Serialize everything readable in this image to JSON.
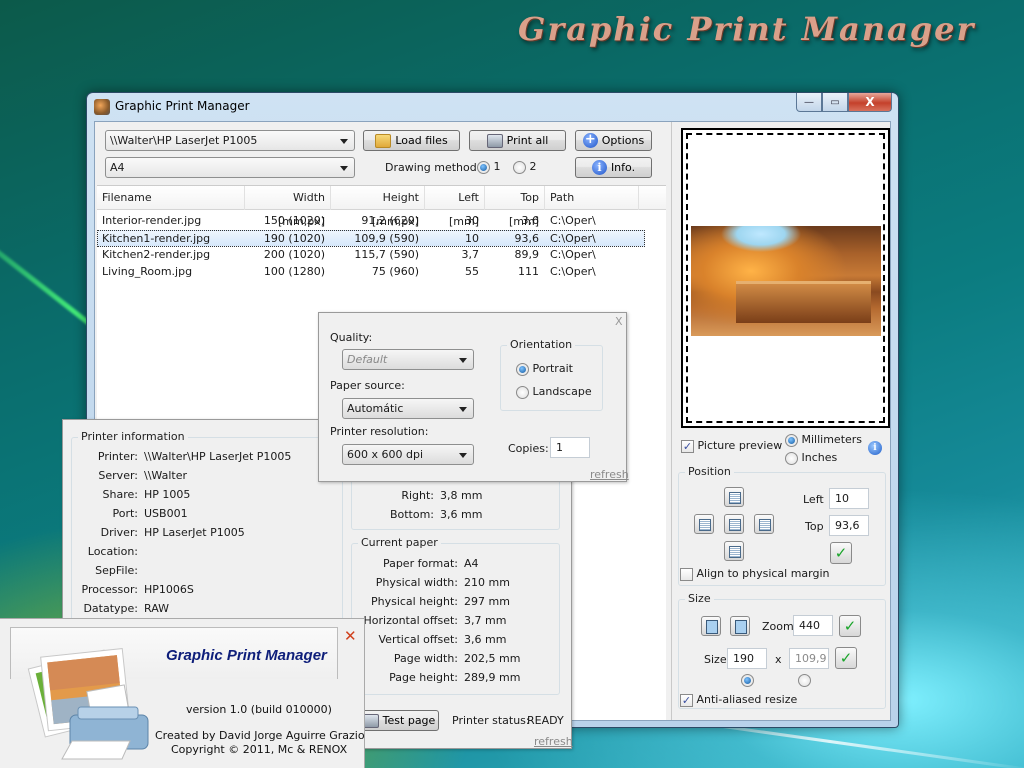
{
  "desktop": {
    "brand_title": "Graphic Print Manager"
  },
  "window": {
    "title": "Graphic Print Manager",
    "controls": {
      "minimize": "—",
      "maximize": "▭",
      "close": "X"
    }
  },
  "toolbar": {
    "printer_select": "\\\\Walter\\HP LaserJet P1005",
    "paper_select": "A4",
    "load_files": "Load files",
    "print_all": "Print all",
    "options": "Options",
    "info": "Info.",
    "drawing_method_label": "Drawing method",
    "drawing_method_options": [
      "1",
      "2"
    ],
    "drawing_method_selected": "1"
  },
  "file_list": {
    "columns": [
      "Filename",
      "Width [mm,px]",
      "Height [mm,px]",
      "Left [mm]",
      "Top [mm]",
      "Path"
    ],
    "rows": [
      {
        "filename": "Interior-render.jpg",
        "width": "150 (1020)",
        "height": "91,2 (620)",
        "left": "30",
        "top": "3,6",
        "path": "C:\\Oper\\",
        "selected": false
      },
      {
        "filename": "Kitchen1-render.jpg",
        "width": "190 (1020)",
        "height": "109,9 (590)",
        "left": "10",
        "top": "93,6",
        "path": "C:\\Oper\\",
        "selected": true
      },
      {
        "filename": "Kitchen2-render.jpg",
        "width": "200 (1020)",
        "height": "115,7 (590)",
        "left": "3,7",
        "top": "89,9",
        "path": "C:\\Oper\\",
        "selected": false
      },
      {
        "filename": "Living_Room.jpg",
        "width": "100 (1280)",
        "height": "75 (960)",
        "left": "55",
        "top": "111",
        "path": "C:\\Oper\\",
        "selected": false
      }
    ]
  },
  "printer_options": {
    "close": "X",
    "quality_label": "Quality:",
    "quality_value": "Default",
    "paper_source_label": "Paper source:",
    "paper_source_value": "Automátic",
    "resolution_label": "Printer resolution:",
    "resolution_value": "600 x 600 dpi",
    "orientation_title": "Orientation",
    "orientation_options": [
      "Portrait",
      "Landscape"
    ],
    "orientation_selected": "Portrait",
    "copies_label": "Copies:",
    "copies_value": "1",
    "refresh": "refresh"
  },
  "printer_info": {
    "title": "Printer information",
    "fields": [
      {
        "key": "Printer:",
        "value": "\\\\Walter\\HP LaserJet P1005"
      },
      {
        "key": "Server:",
        "value": "\\\\Walter"
      },
      {
        "key": "Share:",
        "value": "HP 1005"
      },
      {
        "key": "Port:",
        "value": "USB001"
      },
      {
        "key": "Driver:",
        "value": "HP LaserJet P1005"
      },
      {
        "key": "Location:",
        "value": ""
      },
      {
        "key": "SepFile:",
        "value": ""
      },
      {
        "key": "Processor:",
        "value": "HP1006S"
      },
      {
        "key": "Datatype:",
        "value": "RAW"
      }
    ]
  },
  "margins": {
    "fields": [
      {
        "key": "Right:",
        "value": "3,8 mm"
      },
      {
        "key": "Bottom:",
        "value": "3,6 mm"
      }
    ]
  },
  "current_paper": {
    "title": "Current paper",
    "fields": [
      {
        "key": "Paper format:",
        "value": "A4"
      },
      {
        "key": "Physical width:",
        "value": "210 mm"
      },
      {
        "key": "Physical height:",
        "value": "297 mm"
      },
      {
        "key": "Horizontal offset:",
        "value": "3,7 mm"
      },
      {
        "key": "Vertical offset:",
        "value": "3,6 mm"
      },
      {
        "key": "Page width:",
        "value": "202,5 mm"
      },
      {
        "key": "Page height:",
        "value": "289,9 mm"
      }
    ],
    "test_page": "Test page",
    "printer_status_label": "Printer status:",
    "printer_status_value": "READY",
    "refresh": "refresh"
  },
  "about": {
    "title": "Graphic Print Manager",
    "version": "version 1.0 (build 010000)",
    "created_by": "Created by David Jorge Aguirre Grazio",
    "copyright": "Copyright © 2011, Mc & RENOX",
    "close": "✕"
  },
  "right_panel": {
    "picture_preview_label": "Picture preview",
    "picture_preview_checked": true,
    "units_options": [
      "Millimeters",
      "Inches"
    ],
    "units_selected": "Millimeters",
    "position_title": "Position",
    "left_label": "Left",
    "left_value": "10",
    "top_label": "Top",
    "top_value": "93,6",
    "align_margin_label": "Align to physical margin",
    "align_margin_checked": false,
    "size_title": "Size",
    "zoom_label": "Zoom",
    "zoom_value": "440",
    "size_label": "Size",
    "size_width": "190",
    "size_x": "x",
    "size_height": "109,9",
    "size_lock_selected": "width",
    "anti_aliased_label": "Anti-aliased resize",
    "anti_aliased_checked": true,
    "ok_glyph": "✓",
    "info_glyph": "i"
  }
}
